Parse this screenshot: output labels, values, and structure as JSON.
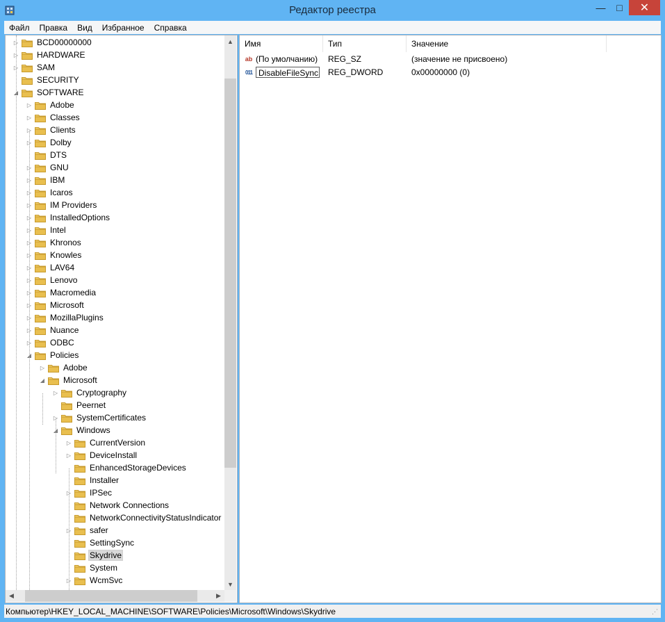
{
  "window": {
    "title": "Редактор реестра"
  },
  "titlebar": {
    "minimize": "—",
    "maximize": "□",
    "close": "✕"
  },
  "menu": [
    "Файл",
    "Правка",
    "Вид",
    "Избранное",
    "Справка"
  ],
  "tree": [
    {
      "label": "BCD00000000",
      "level": 0,
      "exp": "▷"
    },
    {
      "label": "HARDWARE",
      "level": 0,
      "exp": "▷"
    },
    {
      "label": "SAM",
      "level": 0,
      "exp": "▷"
    },
    {
      "label": "SECURITY",
      "level": 0,
      "exp": ""
    },
    {
      "label": "SOFTWARE",
      "level": 0,
      "exp": "◢"
    },
    {
      "label": "Adobe",
      "level": 1,
      "exp": "▷"
    },
    {
      "label": "Classes",
      "level": 1,
      "exp": "▷"
    },
    {
      "label": "Clients",
      "level": 1,
      "exp": "▷"
    },
    {
      "label": "Dolby",
      "level": 1,
      "exp": "▷"
    },
    {
      "label": "DTS",
      "level": 1,
      "exp": ""
    },
    {
      "label": "GNU",
      "level": 1,
      "exp": "▷"
    },
    {
      "label": "IBM",
      "level": 1,
      "exp": "▷"
    },
    {
      "label": "Icaros",
      "level": 1,
      "exp": "▷"
    },
    {
      "label": "IM Providers",
      "level": 1,
      "exp": "▷"
    },
    {
      "label": "InstalledOptions",
      "level": 1,
      "exp": "▷"
    },
    {
      "label": "Intel",
      "level": 1,
      "exp": "▷"
    },
    {
      "label": "Khronos",
      "level": 1,
      "exp": "▷"
    },
    {
      "label": "Knowles",
      "level": 1,
      "exp": "▷"
    },
    {
      "label": "LAV64",
      "level": 1,
      "exp": "▷"
    },
    {
      "label": "Lenovo",
      "level": 1,
      "exp": "▷"
    },
    {
      "label": "Macromedia",
      "level": 1,
      "exp": "▷"
    },
    {
      "label": "Microsoft",
      "level": 1,
      "exp": "▷"
    },
    {
      "label": "MozillaPlugins",
      "level": 1,
      "exp": "▷"
    },
    {
      "label": "Nuance",
      "level": 1,
      "exp": "▷"
    },
    {
      "label": "ODBC",
      "level": 1,
      "exp": "▷"
    },
    {
      "label": "Policies",
      "level": 1,
      "exp": "◢"
    },
    {
      "label": "Adobe",
      "level": 2,
      "exp": "▷"
    },
    {
      "label": "Microsoft",
      "level": 2,
      "exp": "◢"
    },
    {
      "label": "Cryptography",
      "level": 3,
      "exp": "▷"
    },
    {
      "label": "Peernet",
      "level": 3,
      "exp": ""
    },
    {
      "label": "SystemCertificates",
      "level": 3,
      "exp": "▷"
    },
    {
      "label": "Windows",
      "level": 3,
      "exp": "◢"
    },
    {
      "label": "CurrentVersion",
      "level": 4,
      "exp": "▷"
    },
    {
      "label": "DeviceInstall",
      "level": 4,
      "exp": "▷"
    },
    {
      "label": "EnhancedStorageDevices",
      "level": 4,
      "exp": ""
    },
    {
      "label": "Installer",
      "level": 4,
      "exp": ""
    },
    {
      "label": "IPSec",
      "level": 4,
      "exp": "▷"
    },
    {
      "label": "Network Connections",
      "level": 4,
      "exp": ""
    },
    {
      "label": "NetworkConnectivityStatusIndicator",
      "level": 4,
      "exp": ""
    },
    {
      "label": "safer",
      "level": 4,
      "exp": "▷"
    },
    {
      "label": "SettingSync",
      "level": 4,
      "exp": ""
    },
    {
      "label": "Skydrive",
      "level": 4,
      "exp": "",
      "selected": true
    },
    {
      "label": "System",
      "level": 4,
      "exp": ""
    },
    {
      "label": "WcmSvc",
      "level": 4,
      "exp": "▷"
    }
  ],
  "list": {
    "columns": [
      "Имя",
      "Тип",
      "Значение"
    ],
    "rows": [
      {
        "icon": "string-value-icon",
        "glyph": "ab",
        "name": "(По умолчанию)",
        "type": "REG_SZ",
        "value": "(значение не присвоено)"
      },
      {
        "icon": "binary-value-icon",
        "glyph": "011",
        "name": "DisableFileSync",
        "type": "REG_DWORD",
        "value": "0x00000000 (0)",
        "renaming": true
      }
    ]
  },
  "status": {
    "path": "Компьютер\\HKEY_LOCAL_MACHINE\\SOFTWARE\\Policies\\Microsoft\\Windows\\Skydrive"
  },
  "colors": {
    "titlebar": "#60b4f3",
    "close": "#c7443a",
    "folder": "#e9c25a",
    "selection": "#d9d9d9"
  }
}
